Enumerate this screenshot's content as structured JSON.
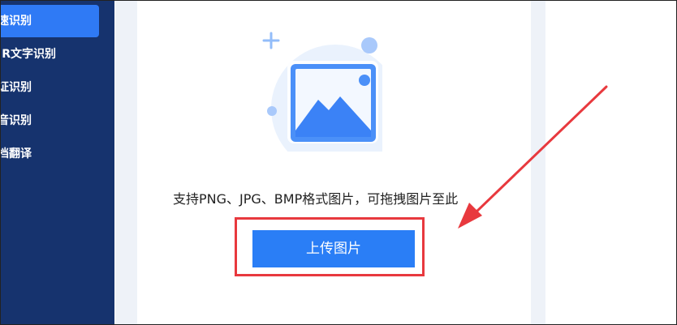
{
  "sidebar": {
    "items": [
      {
        "label": "速识别",
        "active": true
      },
      {
        "label": "R文字识别",
        "active": false
      },
      {
        "label": "证识别",
        "active": false
      },
      {
        "label": "音识别",
        "active": false
      },
      {
        "label": "档翻译",
        "active": false
      }
    ]
  },
  "upload": {
    "hint": "支持PNG、JPG、BMP格式图片，可拖拽图片至此",
    "button_label": "上传图片"
  },
  "colors": {
    "sidebar_bg": "#16336e",
    "accent": "#2a7ef6",
    "annotation_red": "#e8393e"
  },
  "icons": {
    "illustration": "image-placeholder-icon",
    "annotation": "red-arrow-annotation"
  }
}
